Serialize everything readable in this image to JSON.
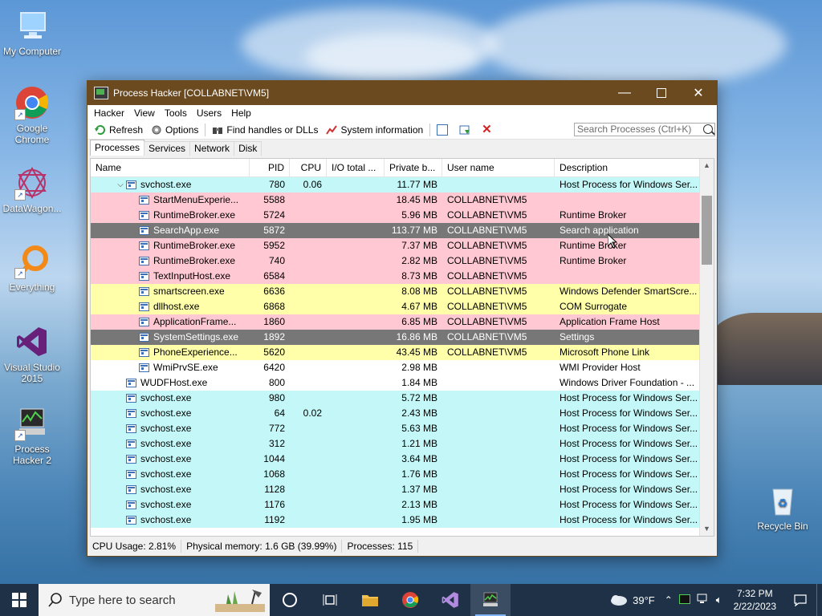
{
  "desktop": {
    "icons": [
      {
        "label": "My Computer"
      },
      {
        "label": "Google Chrome"
      },
      {
        "label": "DataWagon..."
      },
      {
        "label": "Everything"
      },
      {
        "label": "Visual Studio 2015"
      },
      {
        "label": "Process Hacker 2"
      },
      {
        "label": "Recycle Bin"
      }
    ]
  },
  "window": {
    "title": "Process Hacker [COLLABNET\\VM5]",
    "menu": [
      "Hacker",
      "View",
      "Tools",
      "Users",
      "Help"
    ],
    "toolbar": {
      "refresh": "Refresh",
      "options": "Options",
      "find_handles": "Find handles or DLLs",
      "system_info": "System information"
    },
    "search_placeholder": "Search Processes (Ctrl+K)",
    "tabs": [
      "Processes",
      "Services",
      "Network",
      "Disk"
    ],
    "columns": [
      "Name",
      "PID",
      "CPU",
      "I/O total ...",
      "Private b...",
      "User name",
      "Description"
    ],
    "rows": [
      {
        "name": "svchost.exe",
        "pid": "780",
        "cpu": "0.06",
        "priv": "11.77 MB",
        "user": "",
        "desc": "Host Process for Windows Ser...",
        "color": "#c4f8f8",
        "level": 1,
        "expander": "⌵"
      },
      {
        "name": "StartMenuExperie...",
        "pid": "5588",
        "cpu": "",
        "priv": "18.45 MB",
        "user": "COLLABNET\\VM5",
        "desc": "",
        "color": "#ffc8d2",
        "level": 2
      },
      {
        "name": "RuntimeBroker.exe",
        "pid": "5724",
        "cpu": "",
        "priv": "5.96 MB",
        "user": "COLLABNET\\VM5",
        "desc": "Runtime Broker",
        "color": "#ffc8d2",
        "level": 2
      },
      {
        "name": "SearchApp.exe",
        "pid": "5872",
        "cpu": "",
        "priv": "113.77 MB",
        "user": "COLLABNET\\VM5",
        "desc": "Search application",
        "color": "#777777",
        "level": 2
      },
      {
        "name": "RuntimeBroker.exe",
        "pid": "5952",
        "cpu": "",
        "priv": "7.37 MB",
        "user": "COLLABNET\\VM5",
        "desc": "Runtime Broker",
        "color": "#ffc8d2",
        "level": 2
      },
      {
        "name": "RuntimeBroker.exe",
        "pid": "740",
        "cpu": "",
        "priv": "2.82 MB",
        "user": "COLLABNET\\VM5",
        "desc": "Runtime Broker",
        "color": "#ffc8d2",
        "level": 2
      },
      {
        "name": "TextInputHost.exe",
        "pid": "6584",
        "cpu": "",
        "priv": "8.73 MB",
        "user": "COLLABNET\\VM5",
        "desc": "",
        "color": "#ffc8d2",
        "level": 2
      },
      {
        "name": "smartscreen.exe",
        "pid": "6636",
        "cpu": "",
        "priv": "8.08 MB",
        "user": "COLLABNET\\VM5",
        "desc": "Windows Defender SmartScre...",
        "color": "#ffffaa",
        "level": 2
      },
      {
        "name": "dllhost.exe",
        "pid": "6868",
        "cpu": "",
        "priv": "4.67 MB",
        "user": "COLLABNET\\VM5",
        "desc": "COM Surrogate",
        "color": "#ffffaa",
        "level": 2
      },
      {
        "name": "ApplicationFrame...",
        "pid": "1860",
        "cpu": "",
        "priv": "6.85 MB",
        "user": "COLLABNET\\VM5",
        "desc": "Application Frame Host",
        "color": "#ffc8d2",
        "level": 2
      },
      {
        "name": "SystemSettings.exe",
        "pid": "1892",
        "cpu": "",
        "priv": "16.86 MB",
        "user": "COLLABNET\\VM5",
        "desc": "Settings",
        "color": "#777777",
        "level": 2
      },
      {
        "name": "PhoneExperience...",
        "pid": "5620",
        "cpu": "",
        "priv": "43.45 MB",
        "user": "COLLABNET\\VM5",
        "desc": "Microsoft Phone Link",
        "color": "#ffffaa",
        "level": 2
      },
      {
        "name": "WmiPrvSE.exe",
        "pid": "6420",
        "cpu": "",
        "priv": "2.98 MB",
        "user": "",
        "desc": "WMI Provider Host",
        "color": "#ffffff",
        "level": 2
      },
      {
        "name": "WUDFHost.exe",
        "pid": "800",
        "cpu": "",
        "priv": "1.84 MB",
        "user": "",
        "desc": "Windows Driver Foundation - ...",
        "color": "#ffffff",
        "level": 1
      },
      {
        "name": "svchost.exe",
        "pid": "980",
        "cpu": "",
        "priv": "5.72 MB",
        "user": "",
        "desc": "Host Process for Windows Ser...",
        "color": "#c4f8f8",
        "level": 1
      },
      {
        "name": "svchost.exe",
        "pid": "64",
        "cpu": "0.02",
        "priv": "2.43 MB",
        "user": "",
        "desc": "Host Process for Windows Ser...",
        "color": "#c4f8f8",
        "level": 1
      },
      {
        "name": "svchost.exe",
        "pid": "772",
        "cpu": "",
        "priv": "5.63 MB",
        "user": "",
        "desc": "Host Process for Windows Ser...",
        "color": "#c4f8f8",
        "level": 1
      },
      {
        "name": "svchost.exe",
        "pid": "312",
        "cpu": "",
        "priv": "1.21 MB",
        "user": "",
        "desc": "Host Process for Windows Ser...",
        "color": "#c4f8f8",
        "level": 1
      },
      {
        "name": "svchost.exe",
        "pid": "1044",
        "cpu": "",
        "priv": "3.64 MB",
        "user": "",
        "desc": "Host Process for Windows Ser...",
        "color": "#c4f8f8",
        "level": 1
      },
      {
        "name": "svchost.exe",
        "pid": "1068",
        "cpu": "",
        "priv": "1.76 MB",
        "user": "",
        "desc": "Host Process for Windows Ser...",
        "color": "#c4f8f8",
        "level": 1
      },
      {
        "name": "svchost.exe",
        "pid": "1128",
        "cpu": "",
        "priv": "1.37 MB",
        "user": "",
        "desc": "Host Process for Windows Ser...",
        "color": "#c4f8f8",
        "level": 1
      },
      {
        "name": "svchost.exe",
        "pid": "1176",
        "cpu": "",
        "priv": "2.13 MB",
        "user": "",
        "desc": "Host Process for Windows Ser...",
        "color": "#c4f8f8",
        "level": 1
      },
      {
        "name": "svchost.exe",
        "pid": "1192",
        "cpu": "",
        "priv": "1.95 MB",
        "user": "",
        "desc": "Host Process for Windows Ser...",
        "color": "#c4f8f8",
        "level": 1
      }
    ],
    "status": {
      "cpu": "CPU Usage: 2.81%",
      "memory": "Physical memory: 1.6 GB (39.99%)",
      "processes": "Processes: 115"
    }
  },
  "taskbar": {
    "search_placeholder": "Type here to search",
    "weather": "39°F",
    "time": "7:32 PM",
    "date": "2/22/2023"
  }
}
